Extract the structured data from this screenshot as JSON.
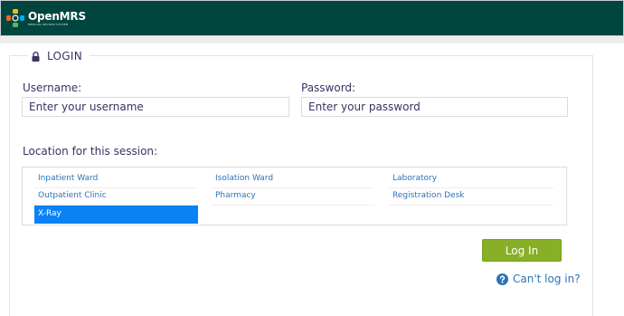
{
  "header": {
    "brand": "OpenMRS",
    "tagline": "MEDICAL RECORD SYSTEM",
    "brand_colors": [
      "#f26522",
      "#fdb913",
      "#5cb85c",
      "#00aeef",
      "#e0e0e0"
    ]
  },
  "login": {
    "legend": "LOGIN",
    "legend_icon": "lock-icon",
    "username_label": "Username:",
    "username_placeholder": "Enter your username",
    "username_value": "",
    "password_label": "Password:",
    "password_placeholder": "Enter your password",
    "password_value": "",
    "location_label": "Location for this session:",
    "locations": [
      {
        "label": "Inpatient Ward",
        "selected": false
      },
      {
        "label": "Isolation Ward",
        "selected": false
      },
      {
        "label": "Laboratory",
        "selected": false
      },
      {
        "label": "Outpatient Clinic",
        "selected": false
      },
      {
        "label": "Pharmacy",
        "selected": false
      },
      {
        "label": "Registration Desk",
        "selected": false
      },
      {
        "label": "X-Ray",
        "selected": true
      }
    ],
    "login_button": "Log In",
    "cant_login": "Can't log in?",
    "cant_login_icon": "question-circle-icon"
  },
  "colors": {
    "header_bg": "#00463f",
    "text": "#363463",
    "link": "#2c73b7",
    "selected_bg": "#0a82f4",
    "button_bg": "#88af28"
  }
}
